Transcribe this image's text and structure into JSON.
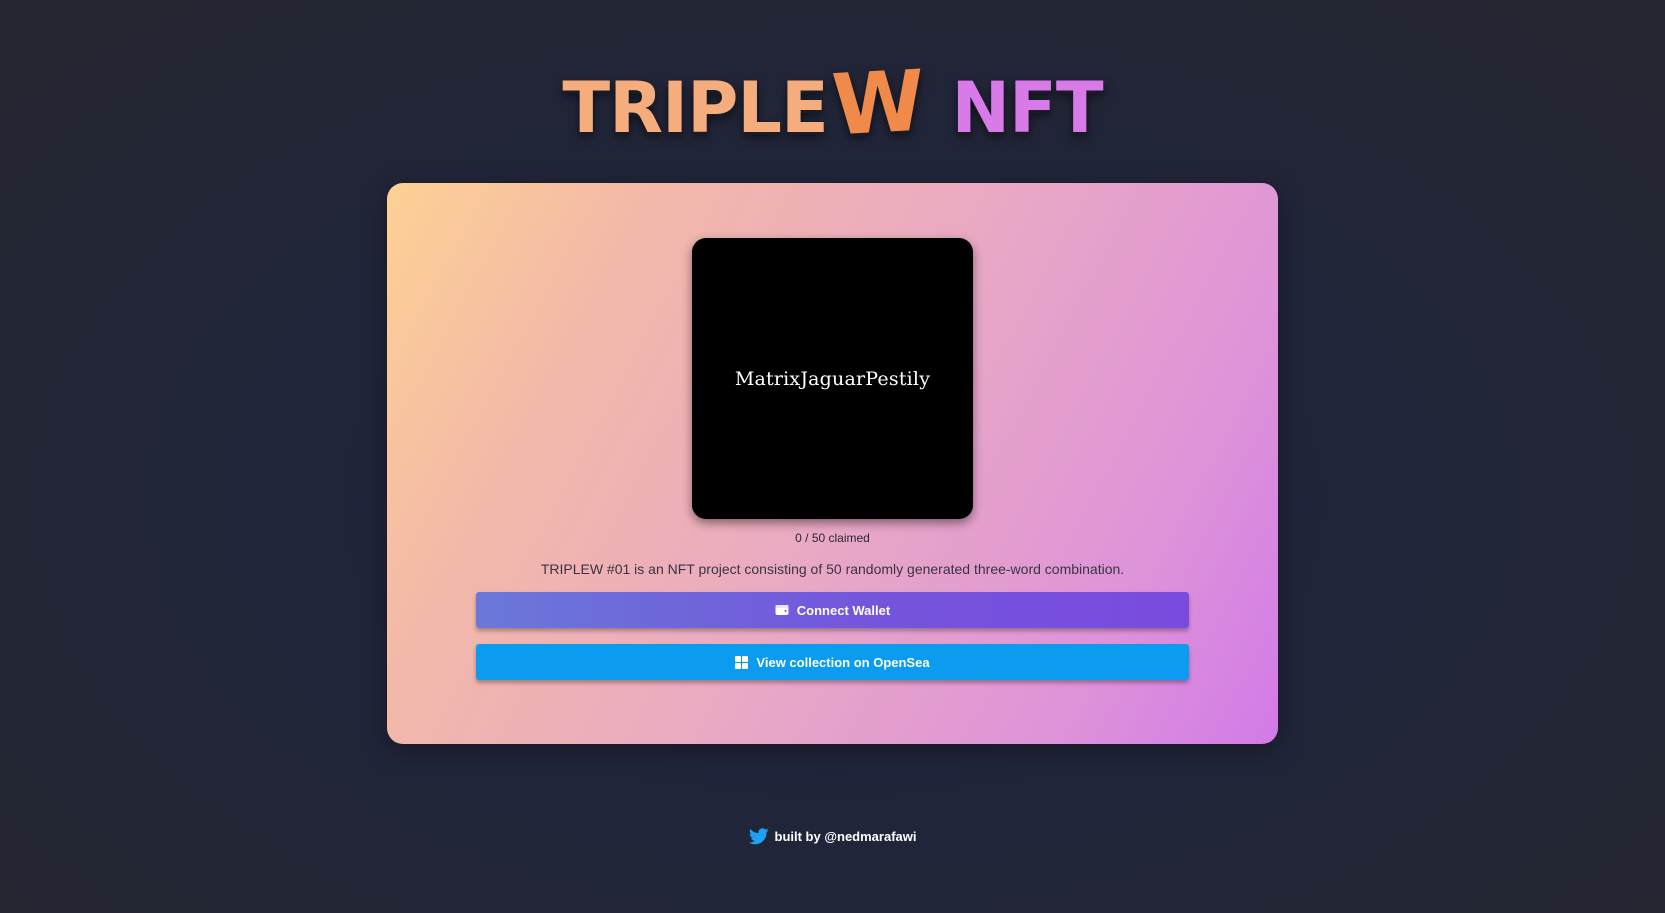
{
  "logo": {
    "part1": "TRIPLE",
    "part2": "W",
    "part3": "NFT",
    "colors": {
      "part1": "#f5ad7e",
      "part2": "#f08a4b",
      "part3": "#d87be8"
    }
  },
  "card": {
    "nft_words": "MatrixJaguarPestily",
    "claimed_text": "0 / 50 claimed",
    "description": "TRIPLEW #01 is an NFT project consisting of 50 randomly generated three-word combination.",
    "connect_button": {
      "label": "Connect Wallet",
      "icon": "wallet-icon"
    },
    "opensea_button": {
      "label": "View collection on OpenSea",
      "icon": "grid-icon"
    }
  },
  "footer": {
    "icon": "twitter-icon",
    "text": "built by @nedmarafawi"
  },
  "colors": {
    "background": "#1f2336",
    "connect_button": "#7455dc",
    "opensea_button": "#0b9bef",
    "twitter": "#1da1f2"
  }
}
